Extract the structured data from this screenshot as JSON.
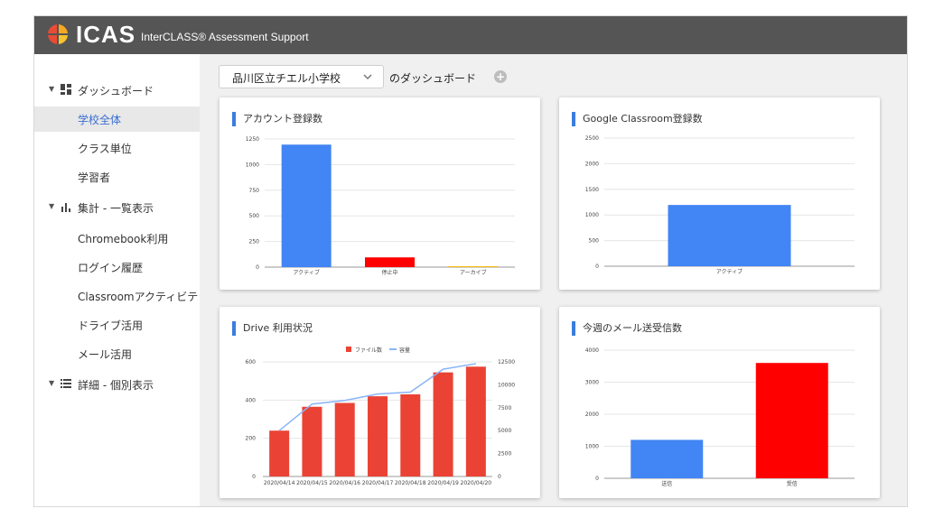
{
  "app": {
    "logo_text": "ICAS",
    "subtitle": "InterCLASS® Assessment Support"
  },
  "sidebar": {
    "groups": [
      {
        "label": "ダッシュボード",
        "icon": "dashboard-icon",
        "items": [
          {
            "label": "学校全体",
            "active": true
          },
          {
            "label": "クラス単位"
          },
          {
            "label": "学習者"
          }
        ]
      },
      {
        "label": "集計 - 一覧表示",
        "icon": "bar-chart-icon",
        "items": [
          {
            "label": "Chromebook利用"
          },
          {
            "label": "ログイン履歴"
          },
          {
            "label": "Classroomアクティビテ"
          },
          {
            "label": "ドライブ活用"
          },
          {
            "label": "メール活用"
          }
        ]
      },
      {
        "label": "詳細 - 個別表示",
        "icon": "list-icon",
        "items": []
      }
    ]
  },
  "header": {
    "school": "品川区立チエル小学校",
    "suffix": "のダッシュボード",
    "add": "+"
  },
  "colors": {
    "blue": "#4285f4",
    "red": "#ff0000",
    "orange": "#ea4335",
    "line": "#8ab4f8",
    "accent": "#3b7ddd"
  },
  "cards": {
    "accounts": {
      "title": "アカウント登録数"
    },
    "classroom": {
      "title": "Google Classroom登録数"
    },
    "drive": {
      "title": "Drive 利用状況"
    },
    "mail": {
      "title": "今週のメール送受信数"
    }
  },
  "chart_data": [
    {
      "type": "bar",
      "title": "アカウント登録数",
      "categories": [
        "アクティブ",
        "停止中",
        "アーカイブ"
      ],
      "values": [
        1195,
        95,
        5
      ],
      "colors": [
        "#4285f4",
        "#ff0000",
        "#fbbc04"
      ],
      "ylim": [
        0,
        1250
      ],
      "yticks": [
        0,
        250,
        500,
        750,
        1000,
        1250
      ]
    },
    {
      "type": "bar",
      "title": "Google Classroom登録数",
      "categories": [
        "アクティブ"
      ],
      "values": [
        1195
      ],
      "colors": [
        "#4285f4"
      ],
      "ylim": [
        0,
        2500
      ],
      "yticks": [
        0,
        500,
        1000,
        1500,
        2000,
        2500
      ]
    },
    {
      "type": "bar",
      "title": "Drive 利用状況",
      "categories": [
        "2020/04/14",
        "2020/04/15",
        "2020/04/16",
        "2020/04/17",
        "2020/04/18",
        "2020/04/19",
        "2020/04/20"
      ],
      "series": [
        {
          "name": "ファイル数",
          "type": "bar",
          "axis": "left",
          "values": [
            240,
            365,
            385,
            420,
            430,
            545,
            575
          ]
        },
        {
          "name": "容量",
          "type": "line",
          "axis": "right",
          "values": [
            5000,
            7900,
            8300,
            9000,
            9200,
            11700,
            12300
          ]
        }
      ],
      "ylim_left": [
        0,
        600
      ],
      "yticks_left": [
        0,
        200,
        400,
        600
      ],
      "ylim_right": [
        0,
        12500
      ],
      "yticks_right": [
        0,
        2500,
        5000,
        7500,
        10000,
        12500
      ],
      "legend": "top"
    },
    {
      "type": "bar",
      "title": "今週のメール送受信数",
      "categories": [
        "送信",
        "受信"
      ],
      "values": [
        1200,
        3600
      ],
      "colors": [
        "#4285f4",
        "#ff0000"
      ],
      "ylim": [
        0,
        4000
      ],
      "yticks": [
        0,
        1000,
        2000,
        3000,
        4000
      ]
    }
  ]
}
